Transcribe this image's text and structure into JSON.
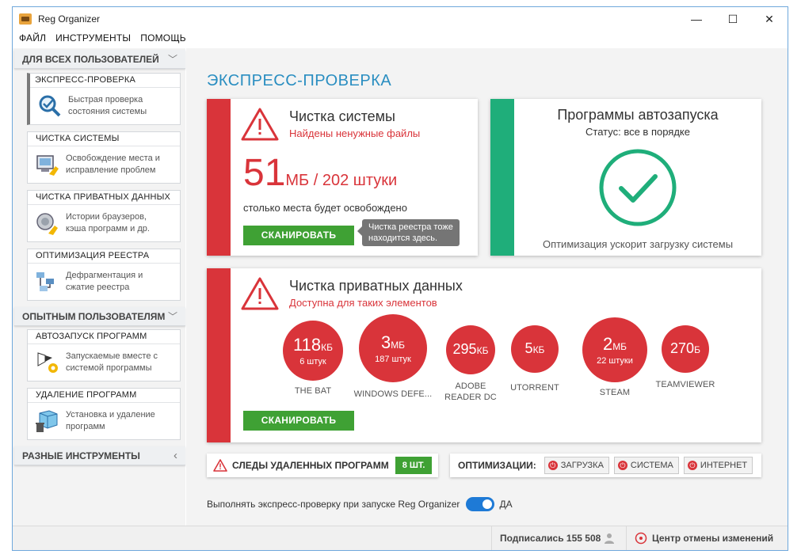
{
  "window": {
    "title": "Reg Organizer",
    "minimize": "—",
    "maximize": "☐",
    "close": "✕"
  },
  "menu": [
    "ФАЙЛ",
    "ИНСТРУМЕНТЫ",
    "ПОМОЩЬ"
  ],
  "sidebar": {
    "section1": "ДЛЯ ВСЕХ ПОЛЬЗОВАТЕЛЕЙ",
    "items1": [
      {
        "title": "ЭКСПРЕСС-ПРОВЕРКА",
        "desc1": "Быстрая проверка",
        "desc2": "состояния системы",
        "icon": "magnifier-check-icon"
      },
      {
        "title": "ЧИСТКА СИСТЕМЫ",
        "desc1": "Освобождение места и",
        "desc2": "исправление проблем",
        "icon": "system-cleanup-icon"
      },
      {
        "title": "ЧИСТКА ПРИВАТНЫХ ДАННЫХ",
        "desc1": "Истории браузеров,",
        "desc2": "кэша программ и др.",
        "icon": "private-data-icon"
      },
      {
        "title": "ОПТИМИЗАЦИЯ РЕЕСТРА",
        "desc1": "Дефрагментация и",
        "desc2": "сжатие реестра",
        "icon": "registry-icon"
      }
    ],
    "section2": "ОПЫТНЫМ ПОЛЬЗОВАТЕЛЯМ",
    "items2": [
      {
        "title": "АВТОЗАПУСК ПРОГРАММ",
        "desc1": "Запускаемые вместе с",
        "desc2": "системой программы",
        "icon": "autorun-icon"
      },
      {
        "title": "УДАЛЕНИЕ ПРОГРАММ",
        "desc1": "Установка и удаление",
        "desc2": "программ",
        "icon": "uninstall-icon"
      }
    ],
    "section3": "РАЗНЫЕ ИНСТРУМЕНТЫ"
  },
  "main": {
    "title": "ЭКСПРЕСС-ПРОВЕРКА",
    "system": {
      "heading": "Чистка системы",
      "sub": "Найдены ненужные файлы",
      "value": "51",
      "unit_rest": "МБ / 202 штуки",
      "caption": "столько места будет освобождено",
      "button": "СКАНИРОВАТЬ",
      "tooltip1": "Чистка реестра тоже",
      "tooltip2": "находится здесь."
    },
    "autorun": {
      "heading": "Программы автозапуска",
      "status": "Статус: все в порядке",
      "footer": "Оптимизация ускорит загрузку системы"
    },
    "private": {
      "heading": "Чистка приватных данных",
      "sub": "Доступна для таких элементов",
      "button": "СКАНИРОВАТЬ",
      "items": [
        {
          "value": "118",
          "unit": "КБ",
          "sub": "6 штук",
          "label1": "THE BAT",
          "label2": ""
        },
        {
          "value": "3",
          "unit": "МБ",
          "sub": "187 штук",
          "label1": "WINDOWS DEFE...",
          "label2": ""
        },
        {
          "value": "295",
          "unit": "КБ",
          "sub": "",
          "label1": "ADOBE",
          "label2": "READER DC"
        },
        {
          "value": "5",
          "unit": "КБ",
          "sub": "",
          "label1": "UTORRENT",
          "label2": ""
        },
        {
          "value": "2",
          "unit": "МБ",
          "sub": "22 штуки",
          "label1": "STEAM",
          "label2": ""
        },
        {
          "value": "270",
          "unit": "Б",
          "sub": "",
          "label1": "TEAMVIEWER",
          "label2": ""
        }
      ]
    },
    "traces": {
      "label": "СЛЕДЫ УДАЛЕННЫХ ПРОГРАММ",
      "count": "8 ШТ."
    },
    "optim": {
      "label": "ОПТИМИЗАЦИИ:",
      "buttons": [
        "ЗАГРУЗКА",
        "СИСТЕМА",
        "ИНТЕРНЕТ"
      ]
    },
    "toggle": {
      "label": "Выполнять экспресс-проверку при запуске Reg Organizer",
      "value": "ДА",
      "on": true
    }
  },
  "status": {
    "subscribed": "Подписались 155 508",
    "undo": "Центр отмены изменений"
  },
  "colors": {
    "red": "#d9343a",
    "green": "#1fae7a",
    "button_green": "#3fa134",
    "title_blue": "#2a8ec1"
  }
}
